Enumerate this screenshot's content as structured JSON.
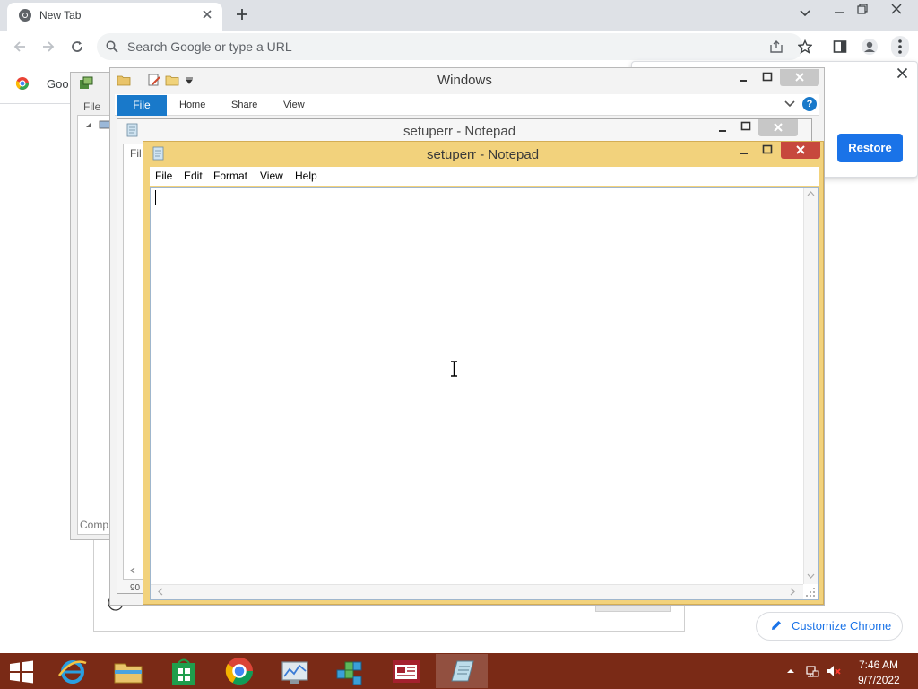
{
  "chrome": {
    "tab_title": "New Tab",
    "omnibox_placeholder": "Search Google or type a URL",
    "bookmark_label": "Goo",
    "restore_label": "Restore",
    "customize_label": "Customize Chrome"
  },
  "explorer": {
    "title": "Windows",
    "ribbon_tabs": [
      "File",
      "Home",
      "Share",
      "View"
    ],
    "help_label": "?"
  },
  "mmc": {
    "menu_file": "File",
    "status_partial": "Comp"
  },
  "notepad_back": {
    "title": "setuperr - Notepad",
    "menu_partial": "Fil",
    "status_partial": "90"
  },
  "notepad_front": {
    "title": "setuperr - Notepad",
    "menu": [
      "File",
      "Edit",
      "Format",
      "View",
      "Help"
    ],
    "content": ""
  },
  "taskbar": {
    "apps": [
      "start",
      "internet-explorer",
      "file-explorer",
      "store",
      "chrome",
      "performance-monitor",
      "registry-editor",
      "news-reader",
      "notepad"
    ],
    "time": "7:46 AM",
    "date": "9/7/2022"
  },
  "colors": {
    "taskbar": "#7a2a16",
    "notepad_active_frame": "#f2d27c",
    "chrome_accent": "#1a73e8",
    "ribbon_file": "#1979ca",
    "close_active": "#c7483d"
  }
}
